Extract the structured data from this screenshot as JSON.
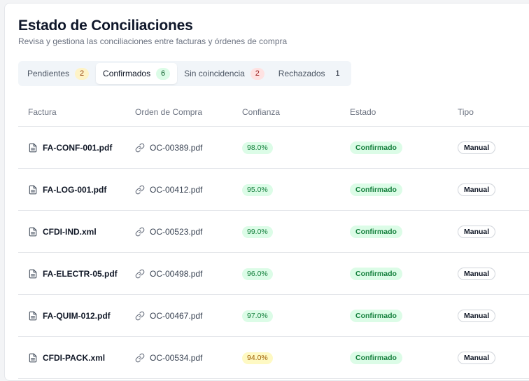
{
  "header": {
    "title": "Estado de Conciliaciones",
    "subtitle": "Revisa y gestiona las conciliaciones entre facturas y órdenes de compra"
  },
  "tabs": [
    {
      "label": "Pendientes",
      "count": "2",
      "color": "#fef3c7",
      "active": false
    },
    {
      "label": "Confirmados",
      "count": "6",
      "color": "#dcfce7",
      "active": true
    },
    {
      "label": "Sin coincidencia",
      "count": "2",
      "color": "#fee2e2",
      "active": false
    },
    {
      "label": "Rechazados",
      "count": "1",
      "color": "transparent",
      "active": false
    }
  ],
  "table": {
    "columns": [
      "Factura",
      "Orden de Compra",
      "Confianza",
      "Estado",
      "Tipo"
    ],
    "rows": [
      {
        "factura": "FA-CONF-001.pdf",
        "orden": "OC-00389.pdf",
        "confianza": "98.0%",
        "estado": "Confirmado",
        "tipo": "Manual"
      },
      {
        "factura": "FA-LOG-001.pdf",
        "orden": "OC-00412.pdf",
        "confianza": "95.0%",
        "estado": "Confirmado",
        "tipo": "Manual"
      },
      {
        "factura": "CFDI-IND.xml",
        "orden": "OC-00523.pdf",
        "confianza": "99.0%",
        "estado": "Confirmado",
        "tipo": "Manual"
      },
      {
        "factura": "FA-ELECTR-05.pdf",
        "orden": "OC-00498.pdf",
        "confianza": "96.0%",
        "estado": "Confirmado",
        "tipo": "Manual"
      },
      {
        "factura": "FA-QUIM-012.pdf",
        "orden": "OC-00467.pdf",
        "confianza": "97.0%",
        "estado": "Confirmado",
        "tipo": "Manual"
      },
      {
        "factura": "CFDI-PACK.xml",
        "orden": "OC-00534.pdf",
        "confianza": "94.0%",
        "estado": "Confirmado",
        "tipo": "Manual"
      }
    ]
  },
  "icons": {
    "factura": "file-text-icon",
    "orden": "link-icon"
  },
  "colors": {
    "confirmed_bg": "#dcfce7",
    "confirmed_text": "#15803d",
    "mid_conf_bg": "#fef9c3"
  }
}
